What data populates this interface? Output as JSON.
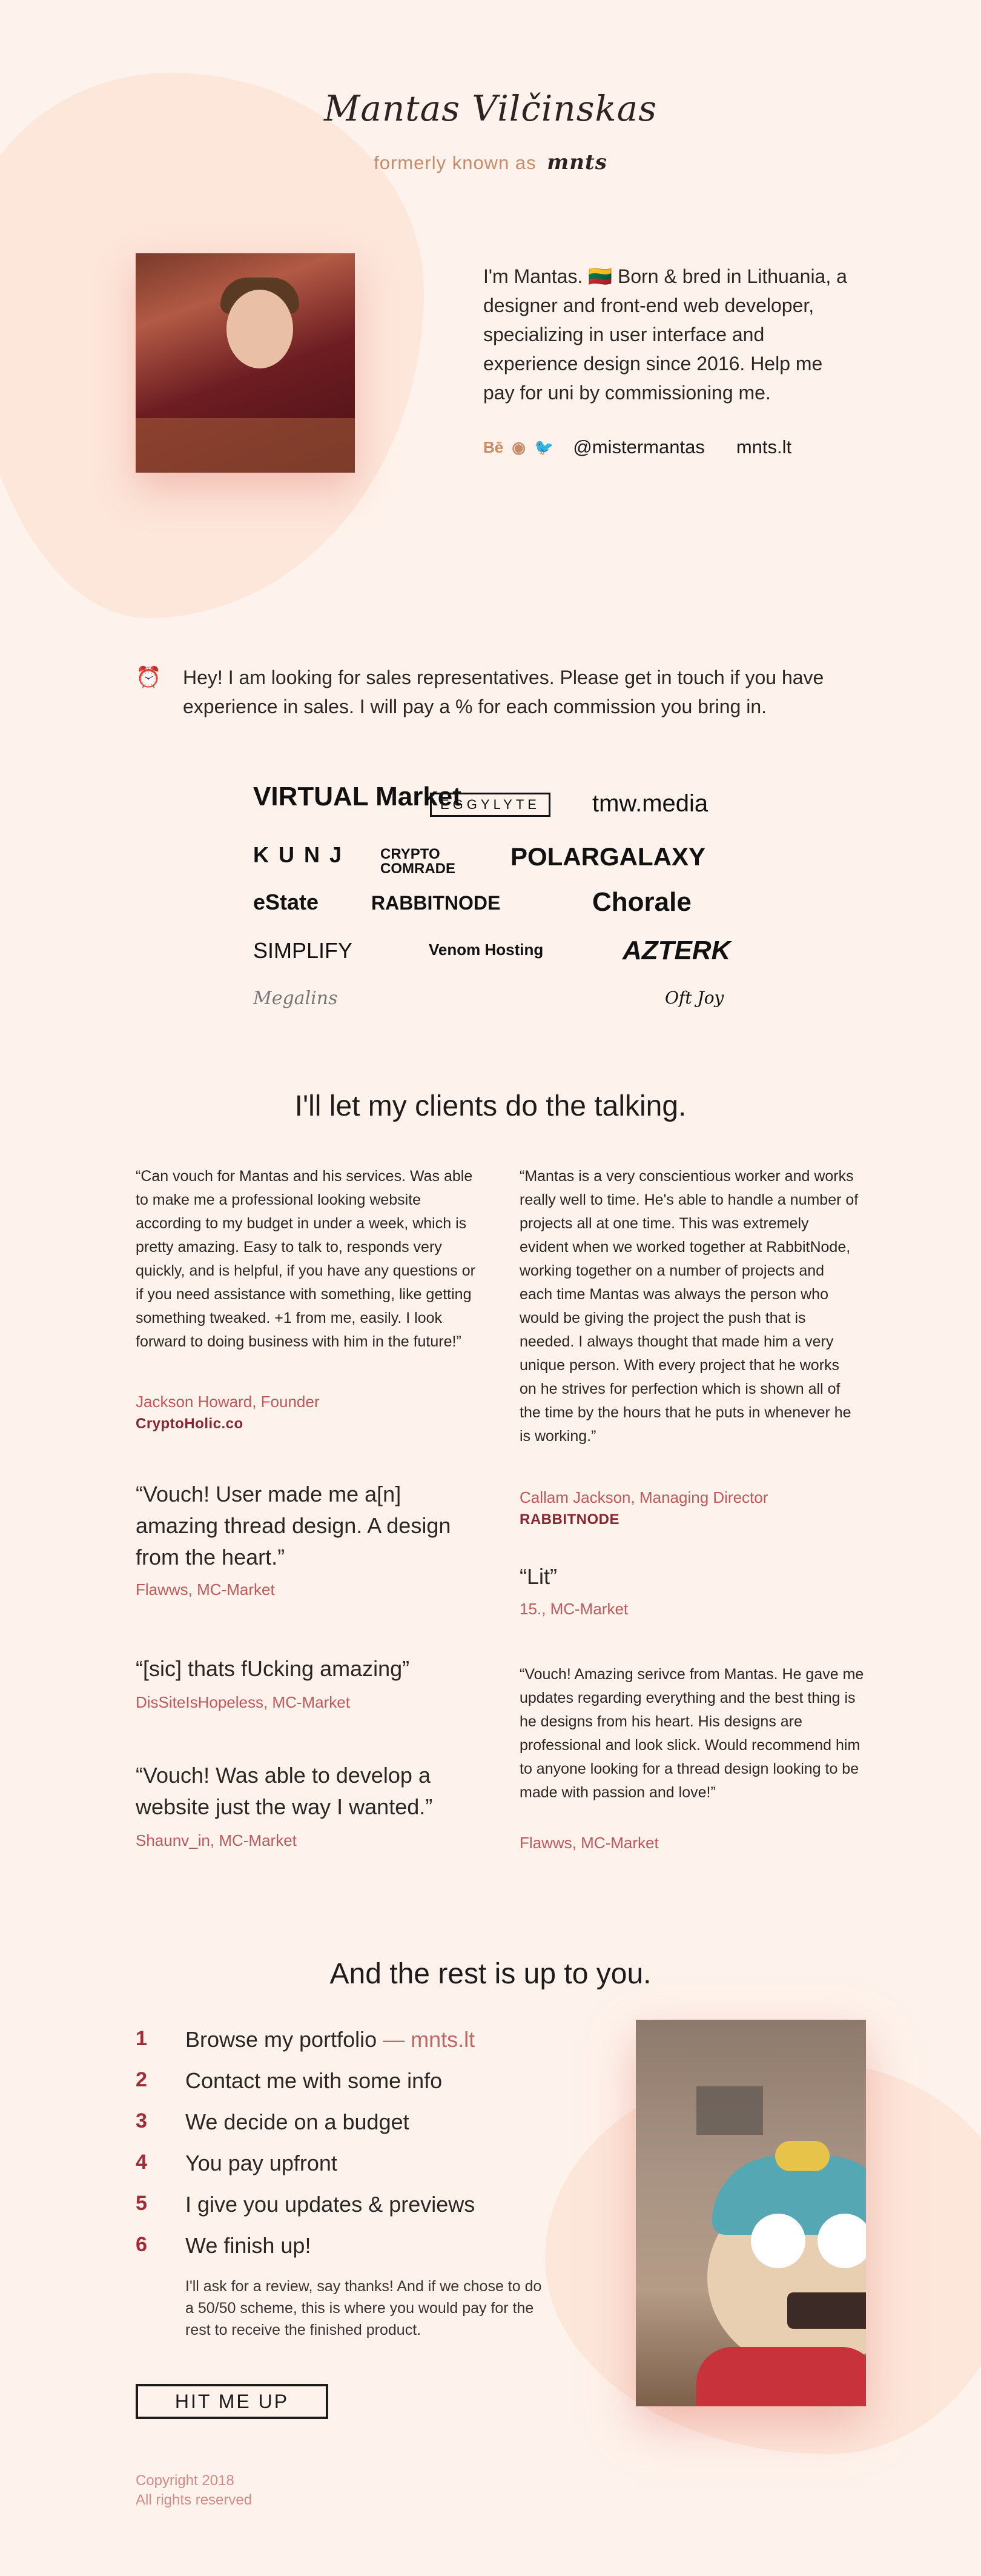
{
  "hero": {
    "name": "Mantas Vilčinskas",
    "formerly_label": "formerly known as",
    "nickname": "mnts"
  },
  "bio": {
    "text": "I'm Mantas. 🇱🇹 Born & bred in Lithuania, a designer and front-end web developer, specializing in user interface and experience design since 2016. Help me pay for uni by commissioning me.",
    "icons": [
      "behance-icon",
      "github-icon",
      "twitter-icon"
    ],
    "icon_glyphs": [
      "Bē",
      "◉",
      "🐦"
    ],
    "handle": "@mistermantas",
    "site": "mnts.lt"
  },
  "notice": {
    "text": "Hey! I am looking for sales representatives. Please get in touch if you have experience in sales. I will pay a % for each commission you bring in."
  },
  "logos": [
    "VIRTUAL Market",
    "EGGYLYTE",
    "tmw.media",
    "KUNJ",
    "CRYPTO COMRADE",
    "POLARGALAXY",
    "eState",
    "RABBITNODE",
    "Chorale",
    "SIMPLIFY",
    "Venom Hosting",
    "AZTERK",
    "Megalins",
    "Oft Joy"
  ],
  "testimonials_title": "I'll let my clients do the talking.",
  "testimonials": [
    {
      "quote": "“Can vouch for Mantas and his services. Was able to make me a professional looking website according to my budget in under a week, which is pretty amazing. Easy to talk to, responds very quickly, and is helpful, if you have any questions or if you need assistance with something, like getting something tweaked. +1 from me, easily. I look forward to doing business with him in the future!”",
      "author": "Jackson Howard, Founder",
      "company": "CryptoHolic.co"
    },
    {
      "quote": "“Vouch! User made me a[n] amazing thread design. A design from the heart.”",
      "author": "Flawws, MC-Market"
    },
    {
      "quote": "“[sic] thats fUcking amazing”",
      "author": "DisSiteIsHopeless, MC-Market"
    },
    {
      "quote": "“Vouch! Was able to develop a website just the way I wanted.”",
      "author": "Shaunv_in, MC-Market"
    },
    {
      "quote": "“Mantas is a very conscientious worker and works really well to time. He's able to handle a number of projects all at one time. This was extremely evident when we worked together at RabbitNode, working together on a number of projects and each time Mantas was always the person who would be giving the project the push that is needed. I always thought that made him a very unique person. With every project that he works on he strives for perfection which is shown all of the time by the hours that he puts in whenever he is working.”",
      "author": "Callam Jackson, Managing Director",
      "company": "RABBITNODE"
    },
    {
      "quote": "“Lit”",
      "author": "15., MC-Market"
    },
    {
      "quote": "“Vouch! Amazing serivce from Mantas. He gave me updates regarding everything and the best thing is he designs from his heart. His designs are professional and look slick. Would recommend him to anyone looking for a thread design looking to be made with passion and love!”",
      "author": "Flawws, MC-Market"
    }
  ],
  "process_title": "And the rest is up to you.",
  "steps": [
    {
      "num": "1",
      "text": "Browse my portfolio",
      "link": "mnts.lt"
    },
    {
      "num": "2",
      "text": "Contact me with some info"
    },
    {
      "num": "3",
      "text": "We decide on a budget"
    },
    {
      "num": "4",
      "text": "You pay upfront"
    },
    {
      "num": "5",
      "text": "I give you updates & previews"
    },
    {
      "num": "6",
      "text": "We finish up!"
    }
  ],
  "step_note": "I'll ask for a review, say thanks! And if we chose to do a 50/50 scheme, this is where you would pay for the rest to receive the finished product.",
  "cta_label": "HIT ME UP",
  "footer": {
    "line1": "Copyright 2018",
    "line2": "All rights reserved"
  },
  "colors": {
    "background": "#fef3ec",
    "accent": "#c98a68",
    "author": "#c0585a",
    "step_number": "#a42a35"
  }
}
